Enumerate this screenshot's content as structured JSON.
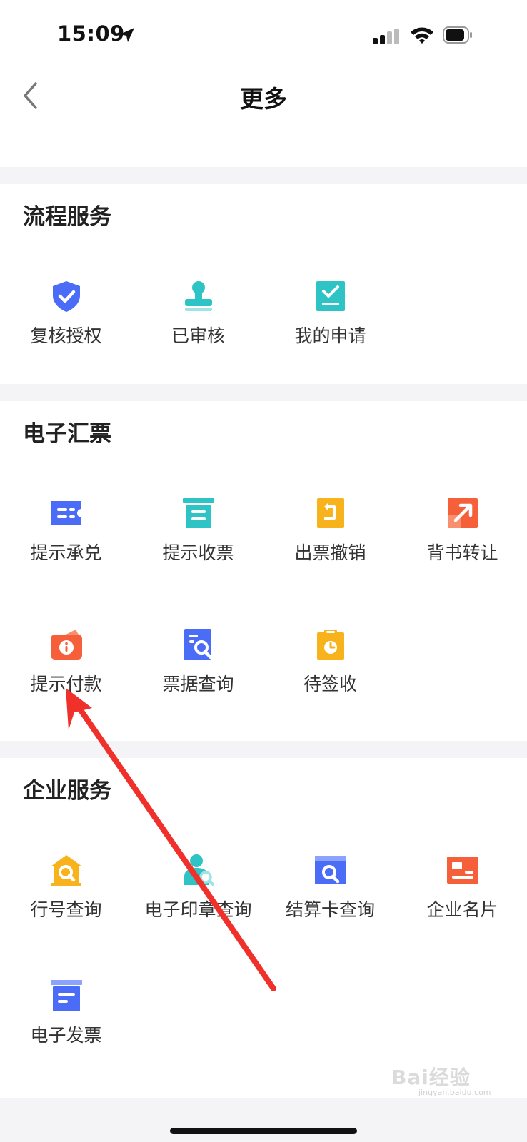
{
  "status_bar": {
    "time": "15:09",
    "icons": [
      "location-arrow-icon",
      "cellular-signal-icon",
      "wifi-icon",
      "battery-icon"
    ]
  },
  "nav": {
    "title": "更多",
    "back_icon": "chevron-left-icon"
  },
  "sections": [
    {
      "title": "流程服务",
      "items": [
        {
          "label": "复核授权",
          "icon": "shield-check-icon",
          "color": "#4a6cf7"
        },
        {
          "label": "已审核",
          "icon": "stamp-icon",
          "color": "#2ec4c6"
        },
        {
          "label": "我的申请",
          "icon": "checklist-icon",
          "color": "#2ec4c6"
        }
      ]
    },
    {
      "title": "电子汇票",
      "items": [
        {
          "label": "提示承兑",
          "icon": "ticket-icon",
          "color": "#4a6cf7"
        },
        {
          "label": "提示收票",
          "icon": "archive-icon",
          "color": "#2ec4c6"
        },
        {
          "label": "出票撤销",
          "icon": "undo-document-icon",
          "color": "#f7b21c"
        },
        {
          "label": "背书转让",
          "icon": "transfer-arrow-icon",
          "color": "#f5603a"
        },
        {
          "label": "提示付款",
          "icon": "wallet-info-icon",
          "color": "#f5603a"
        },
        {
          "label": "票据查询",
          "icon": "document-search-icon",
          "color": "#4a6cf7"
        },
        {
          "label": "待签收",
          "icon": "clipboard-clock-icon",
          "color": "#f7b21c"
        }
      ]
    },
    {
      "title": "企业服务",
      "items": [
        {
          "label": "行号查询",
          "icon": "bank-search-icon",
          "color": "#f7b21c"
        },
        {
          "label": "电子印章查询",
          "icon": "seal-search-icon",
          "color": "#2ec4c6"
        },
        {
          "label": "结算卡查询",
          "icon": "card-search-icon",
          "color": "#4a6cf7"
        },
        {
          "label": "企业名片",
          "icon": "business-card-icon",
          "color": "#f5603a"
        },
        {
          "label": "电子发票",
          "icon": "invoice-box-icon",
          "color": "#4a6cf7"
        }
      ]
    }
  ],
  "annotation": {
    "color": "#f0302a",
    "icon": "red-arrow-icon"
  },
  "watermark": {
    "text": "Bai经验",
    "sub": "jingyan.baidu.com"
  }
}
